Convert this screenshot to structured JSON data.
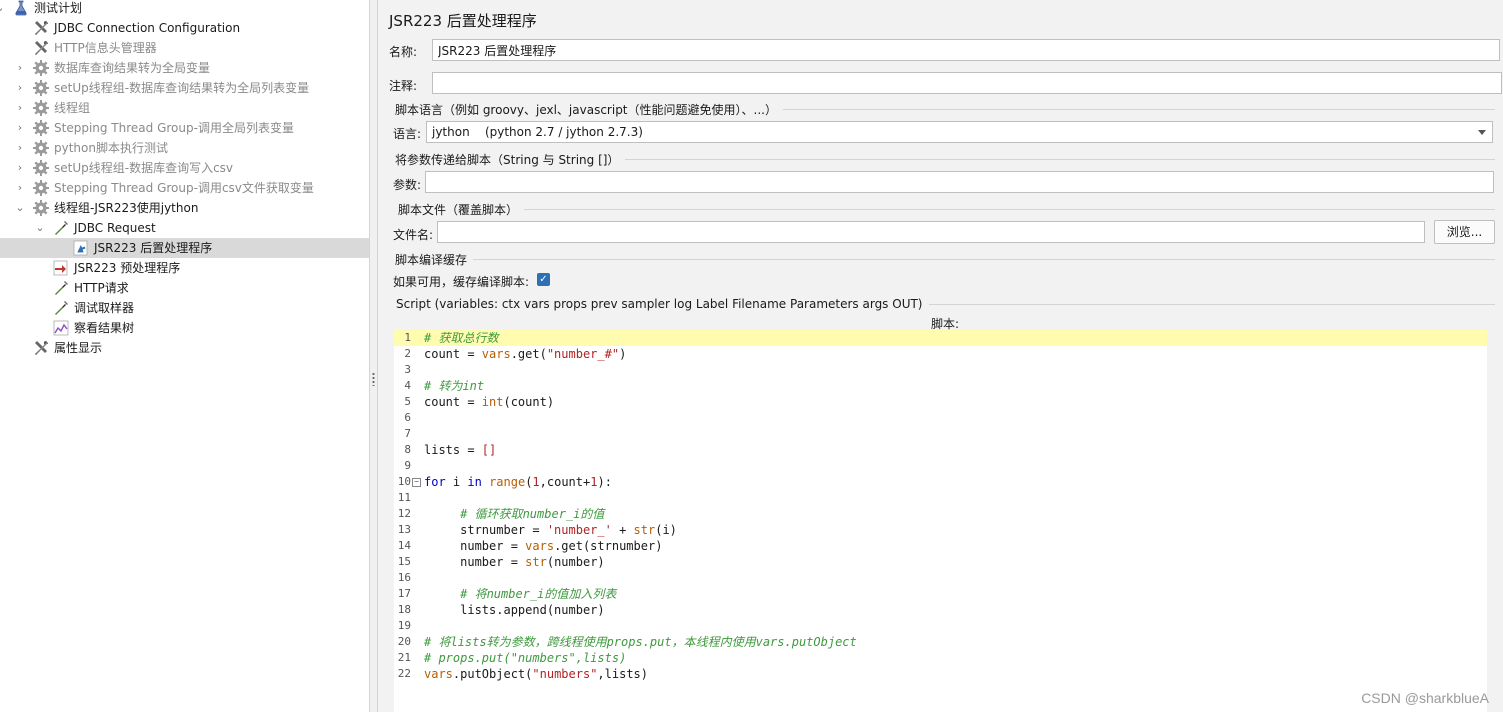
{
  "tree": {
    "items": [
      {
        "label": "测试计划",
        "icon": "test-plan-flask-icon",
        "twisty": "⌄",
        "disabled": false
      },
      {
        "label": "JDBC Connection Configuration",
        "icon": "config-wrench-icon",
        "twisty": "",
        "disabled": false
      },
      {
        "label": "HTTP信息头管理器",
        "icon": "config-wrench-icon",
        "twisty": "",
        "disabled": true
      },
      {
        "label": "数据库查询结果转为全局变量",
        "icon": "thread-group-gear-icon",
        "twisty": "›",
        "disabled": true
      },
      {
        "label": "setUp线程组-数据库查询结果转为全局列表变量",
        "icon": "thread-group-gear-icon",
        "twisty": "›",
        "disabled": true
      },
      {
        "label": "线程组",
        "icon": "thread-group-gear-icon",
        "twisty": "›",
        "disabled": true
      },
      {
        "label": "Stepping Thread Group-调用全局列表变量",
        "icon": "thread-group-gear-icon",
        "twisty": "›",
        "disabled": true
      },
      {
        "label": "python脚本执行测试",
        "icon": "thread-group-gear-icon",
        "twisty": "›",
        "disabled": true
      },
      {
        "label": "setUp线程组-数据库查询写入csv",
        "icon": "thread-group-gear-icon",
        "twisty": "›",
        "disabled": true
      },
      {
        "label": "Stepping Thread Group-调用csv文件获取变量",
        "icon": "thread-group-gear-icon",
        "twisty": "›",
        "disabled": true
      },
      {
        "label": "线程组-JSR223使用jython",
        "icon": "thread-group-gear-icon",
        "twisty": "⌄",
        "disabled": false
      },
      {
        "label": "JDBC Request",
        "icon": "sampler-pipette-icon",
        "twisty": "⌄",
        "disabled": false
      },
      {
        "label": "JSR223 后置处理程序",
        "icon": "post-processor-arrow-icon",
        "twisty": "",
        "disabled": false,
        "selected": true
      },
      {
        "label": "JSR223 预处理程序",
        "icon": "pre-processor-icon",
        "twisty": "",
        "disabled": false
      },
      {
        "label": "HTTP请求",
        "icon": "sampler-pipette-icon",
        "twisty": "",
        "disabled": false
      },
      {
        "label": "调试取样器",
        "icon": "sampler-pipette-icon",
        "twisty": "",
        "disabled": false
      },
      {
        "label": "察看结果树",
        "icon": "listener-chart-icon",
        "twisty": "",
        "disabled": false
      },
      {
        "label": "属性显示",
        "icon": "config-wrench-icon",
        "twisty": "",
        "disabled": false
      }
    ]
  },
  "panel": {
    "title": "JSR223 后置处理程序",
    "name_label": "名称:",
    "name_value": "JSR223 后置处理程序",
    "comment_label": "注释:",
    "comment_value": "",
    "lang_section": "脚本语言（例如 groovy、jexl、javascript（性能问题避免使用）、...）",
    "lang_label": "语言:",
    "lang_value": "jython    (python 2.7 / jython 2.7.3)",
    "params_section": "将参数传递给脚本（String 与 String []）",
    "params_label": "参数:",
    "params_value": "",
    "file_section": "脚本文件（覆盖脚本）",
    "file_label": "文件名:",
    "file_value": "",
    "browse_label": "浏览...",
    "cache_section": "脚本编译缓存",
    "cache_label": "如果可用，缓存编译脚本:",
    "cache_checked": true,
    "script_section": "Script (variables: ctx vars props prev sampler log Label Filename Parameters args OUT)",
    "script_label": "脚本:"
  },
  "editor": {
    "lines": [
      {
        "n": "1",
        "tokens": [
          [
            "cm",
            "# 获取总行数"
          ]
        ],
        "hl": true
      },
      {
        "n": "2",
        "tokens": [
          [
            "tx",
            "count = "
          ],
          [
            "fn",
            "vars"
          ],
          [
            "tx",
            ".get("
          ],
          [
            "st",
            "\"number_#\""
          ],
          [
            "tx",
            ")"
          ]
        ]
      },
      {
        "n": "3",
        "tokens": []
      },
      {
        "n": "4",
        "tokens": [
          [
            "cm",
            "# 转为int"
          ]
        ]
      },
      {
        "n": "5",
        "tokens": [
          [
            "tx",
            "count = "
          ],
          [
            "fn",
            "int"
          ],
          [
            "tx",
            "(count)"
          ]
        ]
      },
      {
        "n": "6",
        "tokens": []
      },
      {
        "n": "7",
        "tokens": []
      },
      {
        "n": "8",
        "tokens": [
          [
            "tx",
            "lists = "
          ],
          [
            "op",
            "[]"
          ]
        ]
      },
      {
        "n": "9",
        "tokens": []
      },
      {
        "n": "10",
        "fold": true,
        "tokens": [
          [
            "kw",
            "for"
          ],
          [
            "tx",
            " i "
          ],
          [
            "kw",
            "in"
          ],
          [
            "tx",
            " "
          ],
          [
            "fn",
            "range"
          ],
          [
            "tx",
            "("
          ],
          [
            "nm",
            "1"
          ],
          [
            "tx",
            ",count+"
          ],
          [
            "nm",
            "1"
          ],
          [
            "tx",
            "):"
          ]
        ]
      },
      {
        "n": "11",
        "tokens": []
      },
      {
        "n": "12",
        "tokens": [
          [
            "tx",
            "     "
          ],
          [
            "cm",
            "# 循环获取number_i的值"
          ]
        ]
      },
      {
        "n": "13",
        "tokens": [
          [
            "tx",
            "     strnumber = "
          ],
          [
            "st",
            "'number_'"
          ],
          [
            "tx",
            " + "
          ],
          [
            "fn",
            "str"
          ],
          [
            "tx",
            "(i)"
          ]
        ]
      },
      {
        "n": "14",
        "tokens": [
          [
            "tx",
            "     number = "
          ],
          [
            "fn",
            "vars"
          ],
          [
            "tx",
            ".get(strnumber)"
          ]
        ]
      },
      {
        "n": "15",
        "tokens": [
          [
            "tx",
            "     number = "
          ],
          [
            "fn",
            "str"
          ],
          [
            "tx",
            "(number)"
          ]
        ]
      },
      {
        "n": "16",
        "tokens": []
      },
      {
        "n": "17",
        "tokens": [
          [
            "tx",
            "     "
          ],
          [
            "cm",
            "# 将number_i的值加入列表"
          ]
        ]
      },
      {
        "n": "18",
        "tokens": [
          [
            "tx",
            "     lists.append(number)"
          ]
        ]
      },
      {
        "n": "19",
        "tokens": []
      },
      {
        "n": "20",
        "tokens": [
          [
            "cm",
            "# 将lists转为参数，跨线程使用props.put，本线程内使用vars.putObject"
          ]
        ]
      },
      {
        "n": "21",
        "tokens": [
          [
            "cm",
            "# props.put(\"numbers\",lists)"
          ]
        ]
      },
      {
        "n": "22",
        "tokens": [
          [
            "fn",
            "vars"
          ],
          [
            "tx",
            ".putObject("
          ],
          [
            "st",
            "\"numbers\""
          ],
          [
            "tx",
            ",lists)"
          ]
        ]
      }
    ]
  },
  "watermark": "CSDN @sharkblueA"
}
